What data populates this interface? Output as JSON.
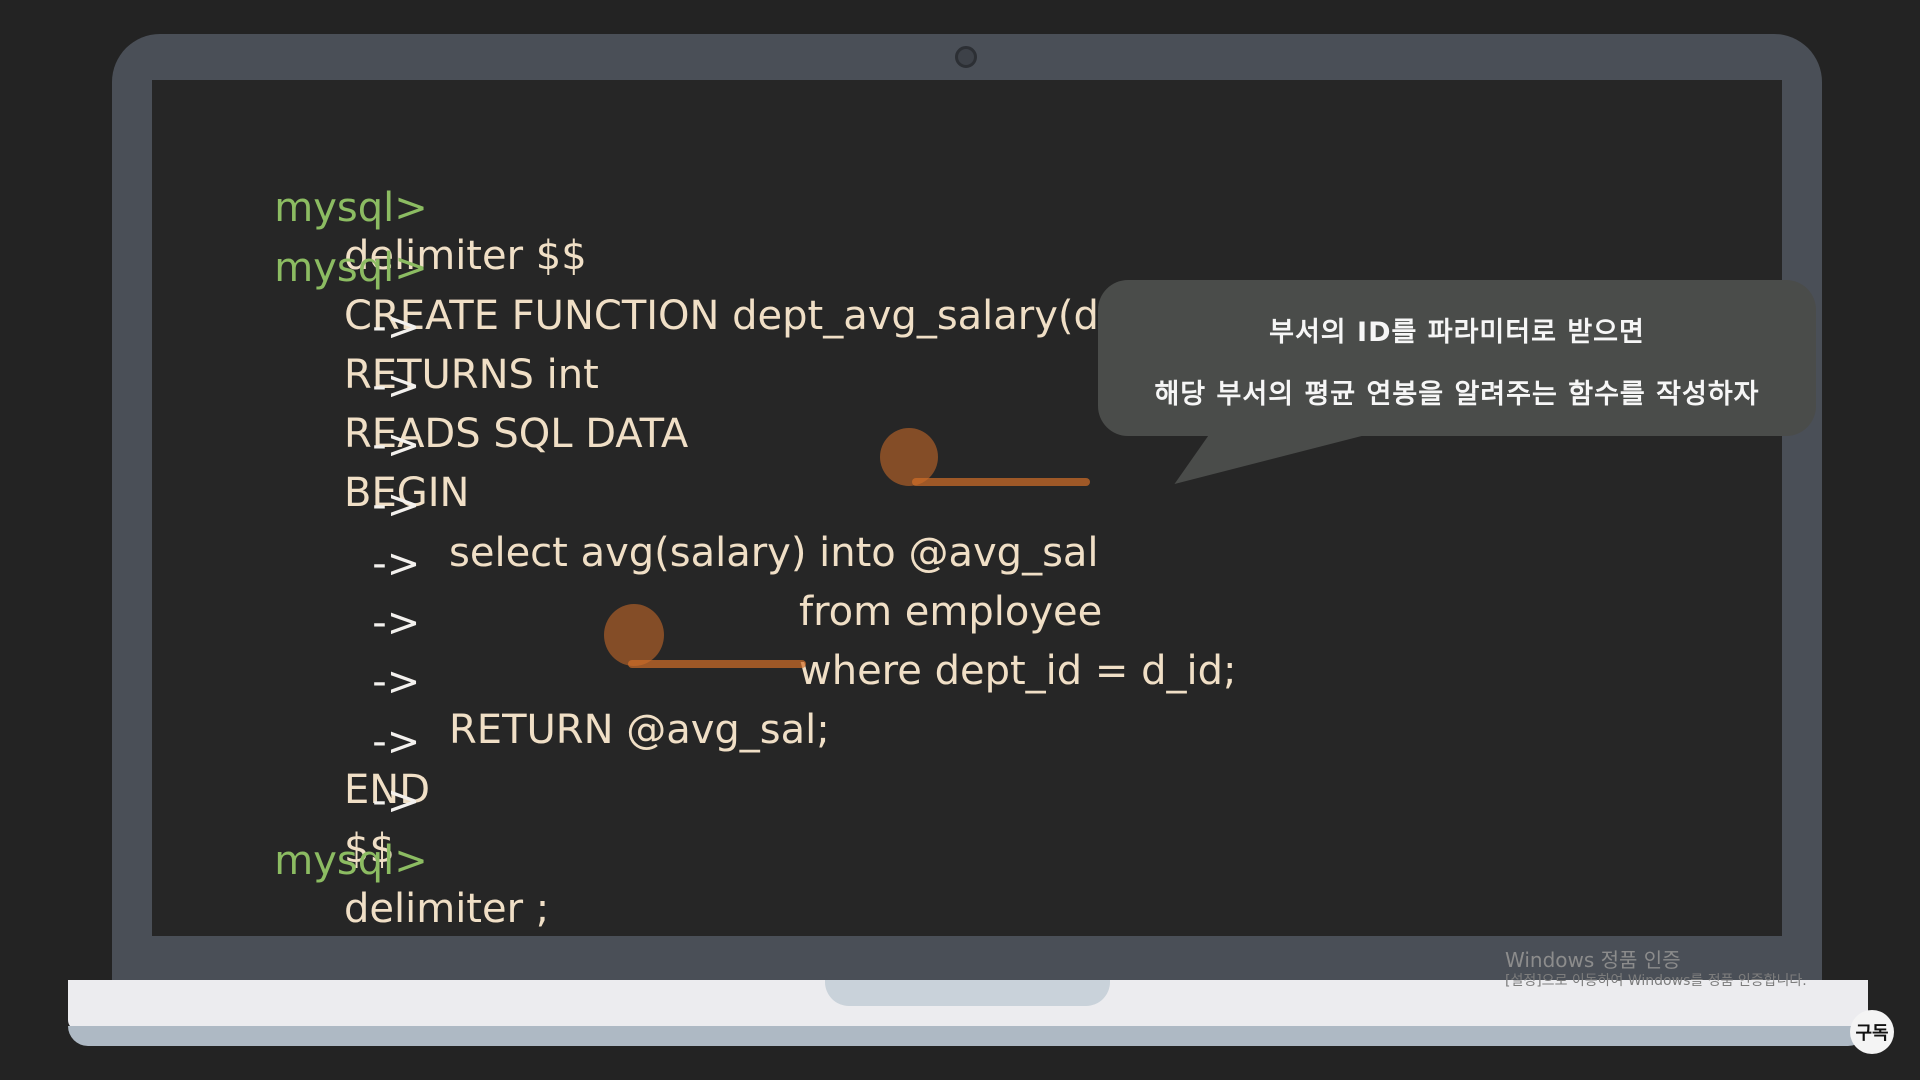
{
  "code_lines": [
    {
      "prompt": "mysql>",
      "text": "delimiter $$"
    },
    {
      "prompt": "mysql>",
      "text": "CREATE FUNCTION dept_avg_salary(d_id int)"
    },
    {
      "prompt": "->",
      "text": "RETURNS int"
    },
    {
      "prompt": "->",
      "text": "READS SQL DATA"
    },
    {
      "prompt": "->",
      "text": "BEGIN"
    },
    {
      "prompt": "->",
      "text": "select avg(salary) into @avg_sal"
    },
    {
      "prompt": "->",
      "text": "from employee"
    },
    {
      "prompt": "->",
      "text": "where dept_id = d_id;"
    },
    {
      "prompt": "->",
      "text": "RETURN @avg_sal;"
    },
    {
      "prompt": "->",
      "text": "END"
    },
    {
      "prompt": "->",
      "text": "$$"
    },
    {
      "prompt": "mysql>",
      "text": "delimiter ;"
    }
  ],
  "callout": {
    "line1": "부서의 ID를 파라미터로 받으면",
    "line2": "해당 부서의 평균 연봉을 알려주는 함수를 작성하자"
  },
  "watermark": {
    "title": "Windows 정품 인증",
    "subtitle": "[설정]으로 이동하여 Windows를 정품 인증합니다."
  },
  "subscribe_label": "구독",
  "colors": {
    "prompt": "#8cbc62",
    "code": "#f0dfc6",
    "highlight": "#d26e28",
    "bubble": "#4a4c4a"
  }
}
